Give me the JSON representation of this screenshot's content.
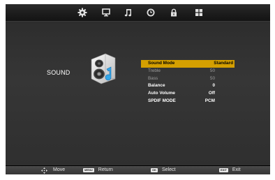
{
  "topbar": {
    "tabs": [
      {
        "icon": "picture-gear-icon",
        "selected": true
      },
      {
        "icon": "screen-icon",
        "selected": false
      },
      {
        "icon": "music-note-icon",
        "selected": false
      },
      {
        "icon": "clock-icon",
        "selected": false
      },
      {
        "icon": "lock-icon",
        "selected": false
      },
      {
        "icon": "grid-icon",
        "selected": false
      }
    ]
  },
  "page": {
    "title": "SOUND",
    "icon": "speaker-icon"
  },
  "menu": {
    "items": [
      {
        "label": "Sound Mode",
        "value": "Standard"
      },
      {
        "label": "Treble",
        "value": "50"
      },
      {
        "label": "Bass",
        "value": "50"
      },
      {
        "label": "Balance",
        "value": "0"
      },
      {
        "label": "Auto Volume",
        "value": "Off"
      },
      {
        "label": "SPDIF MODE",
        "value": "PCM"
      }
    ]
  },
  "footer": {
    "move": {
      "label": "Move",
      "icon": "dpad-icon"
    },
    "return": {
      "key": "MENU",
      "label": "Return"
    },
    "select": {
      "key": "OK",
      "label": "Select"
    },
    "exit": {
      "key": "EXIT",
      "label": "Exit"
    }
  },
  "colors": {
    "highlight": "#d49f00",
    "background": "#000000",
    "panel": "#333333"
  }
}
